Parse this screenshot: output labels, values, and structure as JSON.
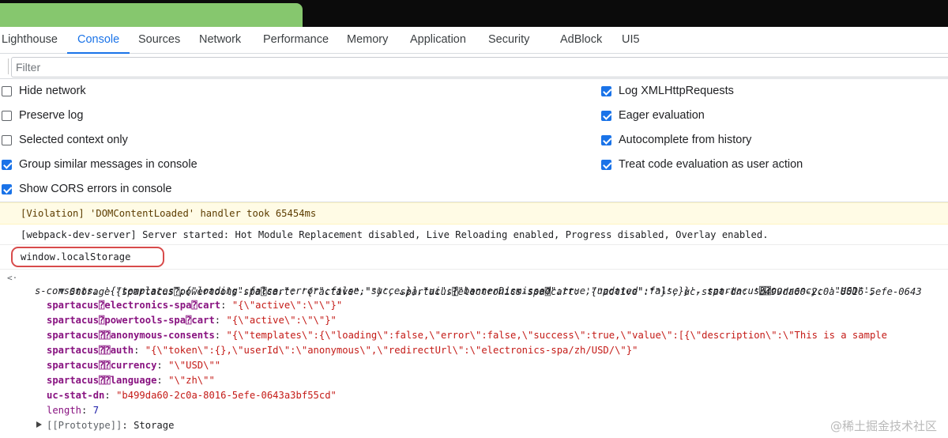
{
  "tabs": [
    "Lighthouse",
    "Console",
    "Sources",
    "Network",
    "Performance",
    "Memory",
    "Application",
    "Security",
    "AdBlock",
    "UI5"
  ],
  "active_tab": "Console",
  "filter": {
    "placeholder": "Filter"
  },
  "settings_left": [
    {
      "label": "Hide network",
      "checked": false
    },
    {
      "label": "Preserve log",
      "checked": false
    },
    {
      "label": "Selected context only",
      "checked": false
    },
    {
      "label": "Group similar messages in console",
      "checked": true
    },
    {
      "label": "Show CORS errors in console",
      "checked": true
    }
  ],
  "settings_right": [
    {
      "label": "Log XMLHttpRequests",
      "checked": true
    },
    {
      "label": "Eager evaluation",
      "checked": true
    },
    {
      "label": "Autocomplete from history",
      "checked": true
    },
    {
      "label": "Treat code evaluation as user action",
      "checked": true
    }
  ],
  "console": {
    "violation": "[Violation] 'DOMContentLoaded' handler took 65454ms",
    "log": "[webpack-dev-server] Server started: Hot Module Replacement disabled, Live Reloading enabled, Progress disabled, Overlay enabled.",
    "command": "window.localStorage",
    "result": {
      "type": "Storage",
      "summary_1": "{spartacus⍰powertools-spa⍰cart: '{\"active\":\"\"}', spartacus⍰electronics-spa⍰cart: '{\"active\":\"\"}', uc-stat-dn: 'b499da60-2c0a-8016-5efe-0643",
      "summary_2": "s-consents: '{\"templates\":{\"loading\":false,\"error\":false,\"succe…}],\"ui\":{\"bannerDismissed\":true,\"updated\":false}}', spartacus⍰⍰currency: '\"USD\"', ",
      "entries": [
        {
          "key": "spartacus⍰electronics-spa⍰cart",
          "value": "\"{\\\"active\\\":\\\"\\\"}\""
        },
        {
          "key": "spartacus⍰powertools-spa⍰cart",
          "value": "\"{\\\"active\\\":\\\"\\\"}\""
        },
        {
          "key": "spartacus⍰⍰anonymous-consents",
          "value": "\"{\\\"templates\\\":{\\\"loading\\\":false,\\\"error\\\":false,\\\"success\\\":true,\\\"value\\\":[{\\\"description\\\":\\\"This is a sample"
        },
        {
          "key": "spartacus⍰⍰auth",
          "value": "\"{\\\"token\\\":{},\\\"userId\\\":\\\"anonymous\\\",\\\"redirectUrl\\\":\\\"electronics-spa/zh/USD/\\\"}\""
        },
        {
          "key": "spartacus⍰⍰currency",
          "value": "\"\\\"USD\\\"\""
        },
        {
          "key": "spartacus⍰⍰language",
          "value": "\"\\\"zh\\\"\""
        },
        {
          "key": "uc-stat-dn",
          "value": "\"b499da60-2c0a-8016-5efe-0643a3bf55cd\""
        }
      ],
      "length_label": "length",
      "length_value": "7",
      "prototype_label": "[[Prototype]]",
      "prototype_value": "Storage"
    }
  },
  "watermark": "@稀土掘金技术社区"
}
